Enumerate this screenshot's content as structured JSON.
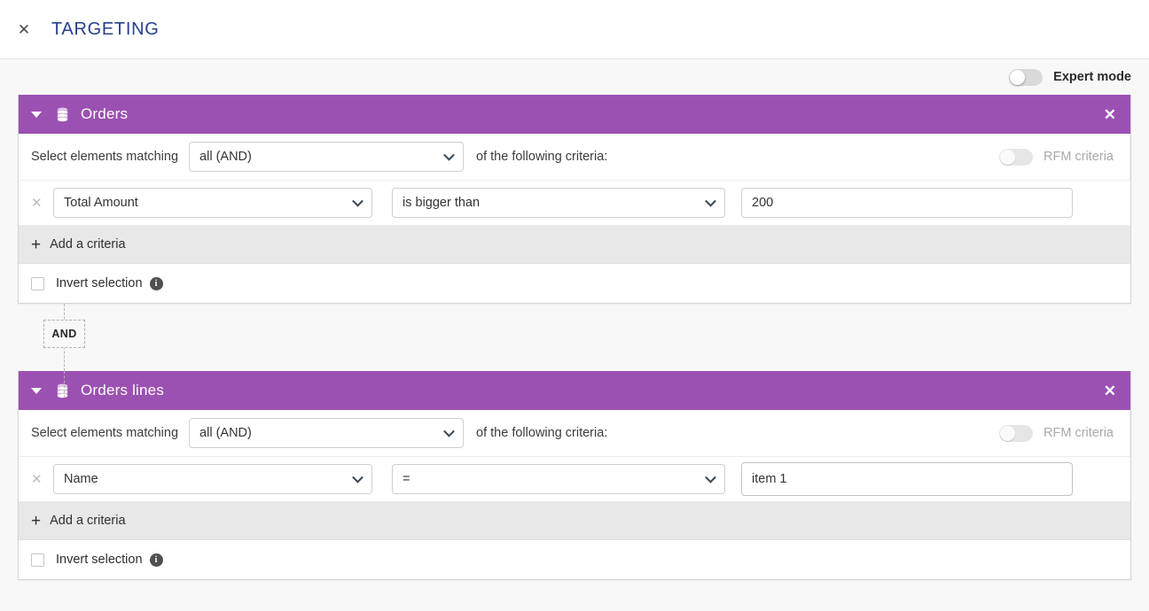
{
  "topbar": {
    "close_icon": "close-icon",
    "title": "TARGETING"
  },
  "expert_mode": {
    "label": "Expert mode",
    "enabled": false
  },
  "colors": {
    "group_header_purple": "#9b51b2",
    "title_blue": "#27408b",
    "add_row_grey": "#e8e8e8",
    "canvas_grey": "#f8f8f8"
  },
  "connector": {
    "label": "AND"
  },
  "groups": [
    {
      "icon": "database-stack-icon",
      "caret": "caret-down-icon",
      "title": "Orders",
      "close_icon": "close-icon",
      "match": {
        "prefix_label": "Select elements matching",
        "selected": "all (AND)",
        "suffix_label": "of the following criteria:"
      },
      "rfm": {
        "label": "RFM criteria",
        "enabled": false
      },
      "criteria": [
        {
          "remove_icon": "remove-criteria-icon",
          "field": "Total Amount",
          "operator": "is bigger than",
          "value": "200",
          "value_placeholder": "",
          "focused": false
        }
      ],
      "add_criteria_label": "Add a criteria",
      "invert": {
        "label": "Invert selection",
        "checked": false,
        "info_icon": "info-icon",
        "info_glyph": "i"
      }
    },
    {
      "icon": "database-stack-icon",
      "caret": "caret-down-icon",
      "title": "Orders lines",
      "close_icon": "close-icon",
      "match": {
        "prefix_label": "Select elements matching",
        "selected": "all (AND)",
        "suffix_label": "of the following criteria:"
      },
      "rfm": {
        "label": "RFM criteria",
        "enabled": false
      },
      "criteria": [
        {
          "remove_icon": "remove-criteria-icon",
          "field": "Name",
          "operator": "=",
          "value": "item 1",
          "value_placeholder": "",
          "focused": true
        }
      ],
      "add_criteria_label": "Add a criteria",
      "invert": {
        "label": "Invert selection",
        "checked": false,
        "info_icon": "info-icon",
        "info_glyph": "i"
      }
    }
  ]
}
